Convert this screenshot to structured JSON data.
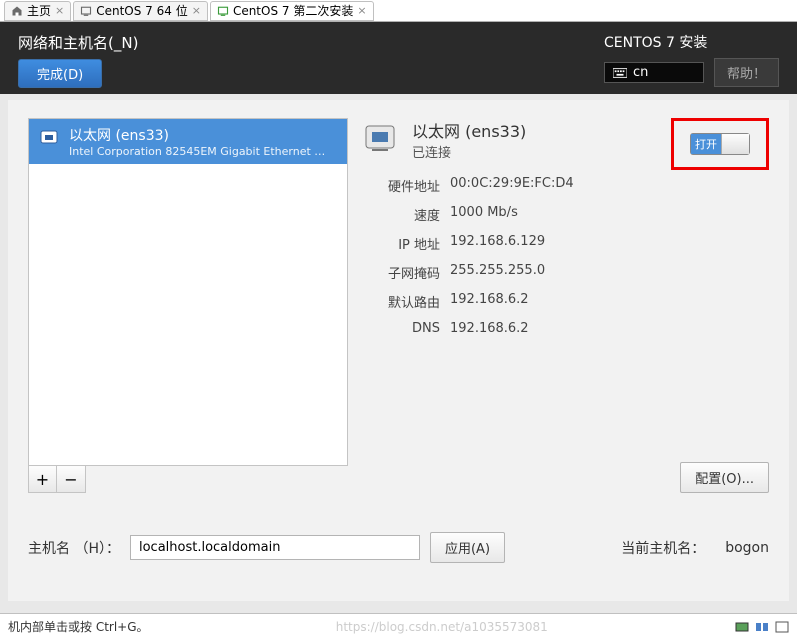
{
  "tabs": [
    {
      "label": "主页"
    },
    {
      "label": "CentOS 7 64 位"
    },
    {
      "label": "CentOS 7 第二次安装"
    }
  ],
  "header": {
    "title": "网络和主机名(_N)",
    "done": "完成(D)",
    "install_title": "CENTOS 7 安装",
    "kbd": "cn",
    "help": "帮助！"
  },
  "device_list": {
    "selected": {
      "name": "以太网 (ens33)",
      "sub": "Intel Corporation 82545EM Gigabit Ethernet Controller (…"
    }
  },
  "btn_add": "+",
  "btn_remove": "−",
  "details": {
    "title": "以太网 (ens33)",
    "status": "已连接",
    "rows": {
      "hw_k": "硬件地址",
      "hw_v": "00:0C:29:9E:FC:D4",
      "sp_k": "速度",
      "sp_v": "1000 Mb/s",
      "ip_k": "IP 地址",
      "ip_v": "192.168.6.129",
      "nm_k": "子网掩码",
      "nm_v": "255.255.255.0",
      "gw_k": "默认路由",
      "gw_v": "192.168.6.2",
      "dn_k": "DNS",
      "dn_v": "192.168.6.2"
    },
    "toggle_on": "打开",
    "configure": "配置(O)..."
  },
  "hostname": {
    "label": "主机名 （H）：",
    "value": "localhost.localdomain",
    "apply": "应用(A)",
    "current_label": "当前主机名：",
    "current_value": "bogon"
  },
  "statusbar": {
    "hint": "机内部单击或按 Ctrl+G。",
    "watermark": "https://blog.csdn.net/a1035573081"
  }
}
